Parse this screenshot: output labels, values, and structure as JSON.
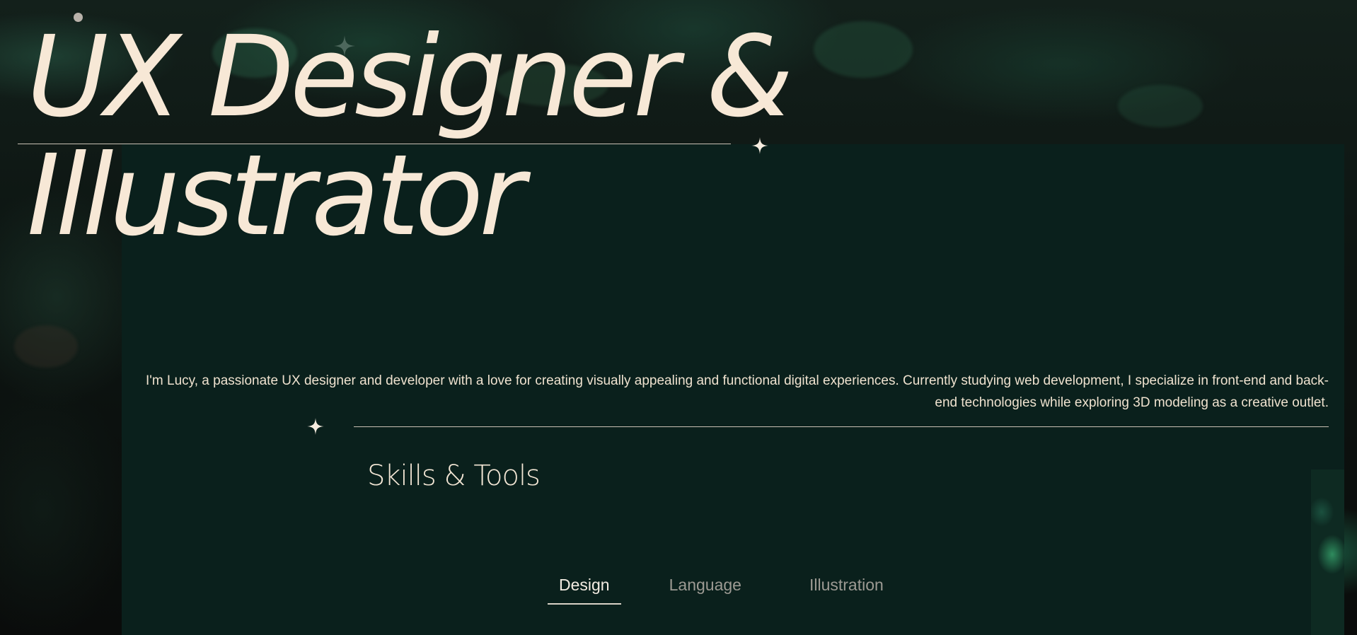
{
  "hero": {
    "title_line_1": "UX Designer &",
    "title_line_2": "Illustrator"
  },
  "intro": {
    "text": "I'm Lucy, a passionate UX designer and developer with a love for creating visually appealing and functional digital experiences. Currently studying web development, I specialize in front-end and back-end technologies while exploring 3D modeling as a creative outlet."
  },
  "skills": {
    "heading": "Skills & Tools",
    "tabs": [
      {
        "label": "Design",
        "active": true
      },
      {
        "label": "Language",
        "active": false
      },
      {
        "label": "Illustration",
        "active": false
      }
    ]
  },
  "icons": {
    "sparkle": "four-point-star-icon",
    "dot": "circle-dot-icon"
  },
  "colors": {
    "panel_bg": "#0a201c",
    "text_cream": "#f7e8d6",
    "tab_inactive": "#9c9a93"
  }
}
